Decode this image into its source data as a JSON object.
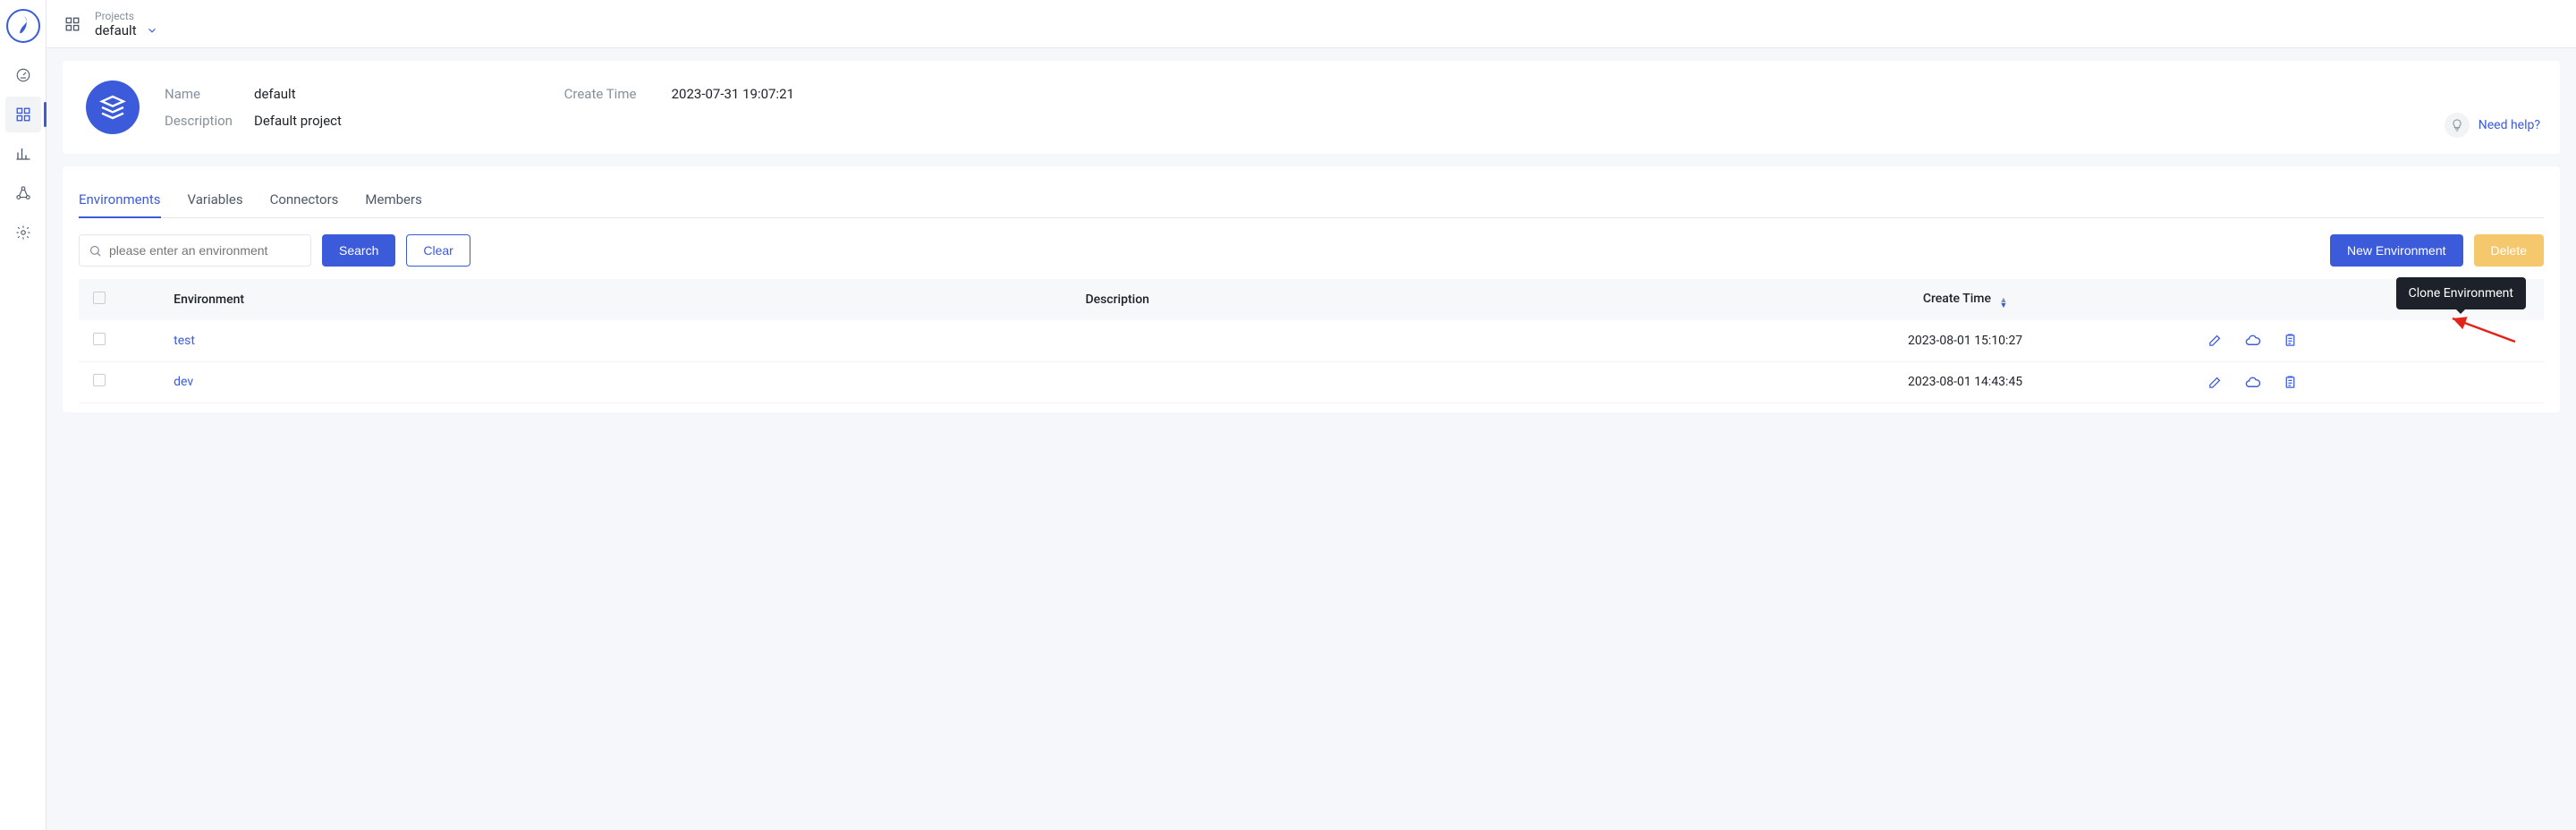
{
  "topbar": {
    "projects_label": "Projects",
    "project_name": "default"
  },
  "sidebar": {
    "items": [
      "dashboard",
      "apps",
      "stats",
      "nodes",
      "settings"
    ]
  },
  "project": {
    "name_label": "Name",
    "name_value": "default",
    "desc_label": "Description",
    "desc_value": "Default project",
    "create_time_label": "Create Time",
    "create_time_value": "2023-07-31 19:07:21",
    "need_help": "Need help?"
  },
  "tabs": {
    "environments": "Environments",
    "variables": "Variables",
    "connectors": "Connectors",
    "members": "Members"
  },
  "toolbar": {
    "search_placeholder": "please enter an environment",
    "search": "Search",
    "clear": "Clear",
    "new_env": "New Environment",
    "delete": "Delete"
  },
  "table": {
    "columns": {
      "env": "Environment",
      "desc": "Description",
      "create_time": "Create Time"
    },
    "rows": [
      {
        "name": "test",
        "desc": "",
        "create_time": "2023-08-01 15:10:27"
      },
      {
        "name": "dev",
        "desc": "",
        "create_time": "2023-08-01 14:43:45"
      }
    ],
    "tooltip_clone": "Clone Environment"
  }
}
